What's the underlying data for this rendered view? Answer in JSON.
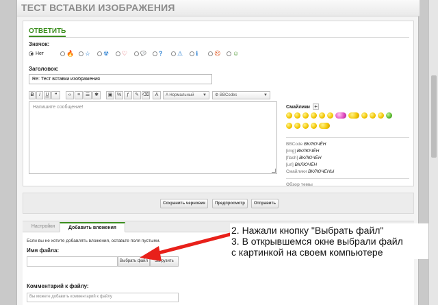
{
  "page": {
    "title": "ТЕСТ ВСТАВКИ ИЗОБРАЖЕНИЯ"
  },
  "reply": {
    "heading": "ОТВЕТИТЬ",
    "icon_label": "Значок:",
    "icons": [
      {
        "name": "none",
        "label": "Нет",
        "selected": true
      },
      {
        "name": "fire-icon",
        "glyph": "🔥"
      },
      {
        "name": "star-icon",
        "glyph": "☆"
      },
      {
        "name": "radiation-icon",
        "glyph": "☢"
      },
      {
        "name": "heart-icon",
        "glyph": "♡"
      },
      {
        "name": "speech-bubble-icon",
        "glyph": "💬"
      },
      {
        "name": "question-icon",
        "glyph": "?"
      },
      {
        "name": "warning-icon",
        "glyph": "⚠"
      },
      {
        "name": "info-icon",
        "glyph": "ℹ"
      },
      {
        "name": "angry-face-icon",
        "glyph": "☹"
      },
      {
        "name": "happy-face-icon",
        "glyph": "☺"
      }
    ],
    "title_label": "Заголовок:",
    "title_value": "Re: Тест вставки изображения",
    "toolbar": {
      "bold": "B",
      "italic": "I",
      "underline": "U",
      "font_select": "Нормальный",
      "bbcodes_select": "BBCodes"
    },
    "editor_placeholder": "Напишите сообщение!"
  },
  "sidebar": {
    "smilies_label": "Смайлики",
    "plus": "+",
    "bbinfo": [
      {
        "name": "BBCode",
        "state": "ВКЛЮЧЁН"
      },
      {
        "name": "[img]",
        "state": "ВКЛЮЧЁН"
      },
      {
        "name": "[flash]",
        "state": "ВКЛЮЧЁН"
      },
      {
        "name": "[url]",
        "state": "ВКЛЮЧЁН"
      },
      {
        "name": "Смайлики",
        "state": "ВКЛЮЧЕНЫ"
      }
    ],
    "overview_link": "Обзор темы"
  },
  "actions": {
    "save_draft": "Сохранить черновик",
    "preview": "Предпросмотр",
    "submit": "Отправить"
  },
  "attach": {
    "tabs": [
      "Настройки",
      "Добавить вложения"
    ],
    "hint": "Если вы не хотите добавлять вложения, оставьте поля пустыми.",
    "filename_label": "Имя файла:",
    "choose_file": "Выбрать файл",
    "upload": "Загрузить",
    "comment_label": "Комментарий к файлу:",
    "comment_placeholder": "Вы можете добавить комментарий к файлу"
  },
  "annotation": {
    "line1": "2. Нажали кнопку \"Выбрать файл\"",
    "line2": "3. В открывшемся окне выбрали файл",
    "line3": "с картинкой на своем компьютере",
    "arrow_color": "#e8201a"
  },
  "colors": {
    "accent": "#3b8e1e",
    "arrow": "#e8201a"
  }
}
